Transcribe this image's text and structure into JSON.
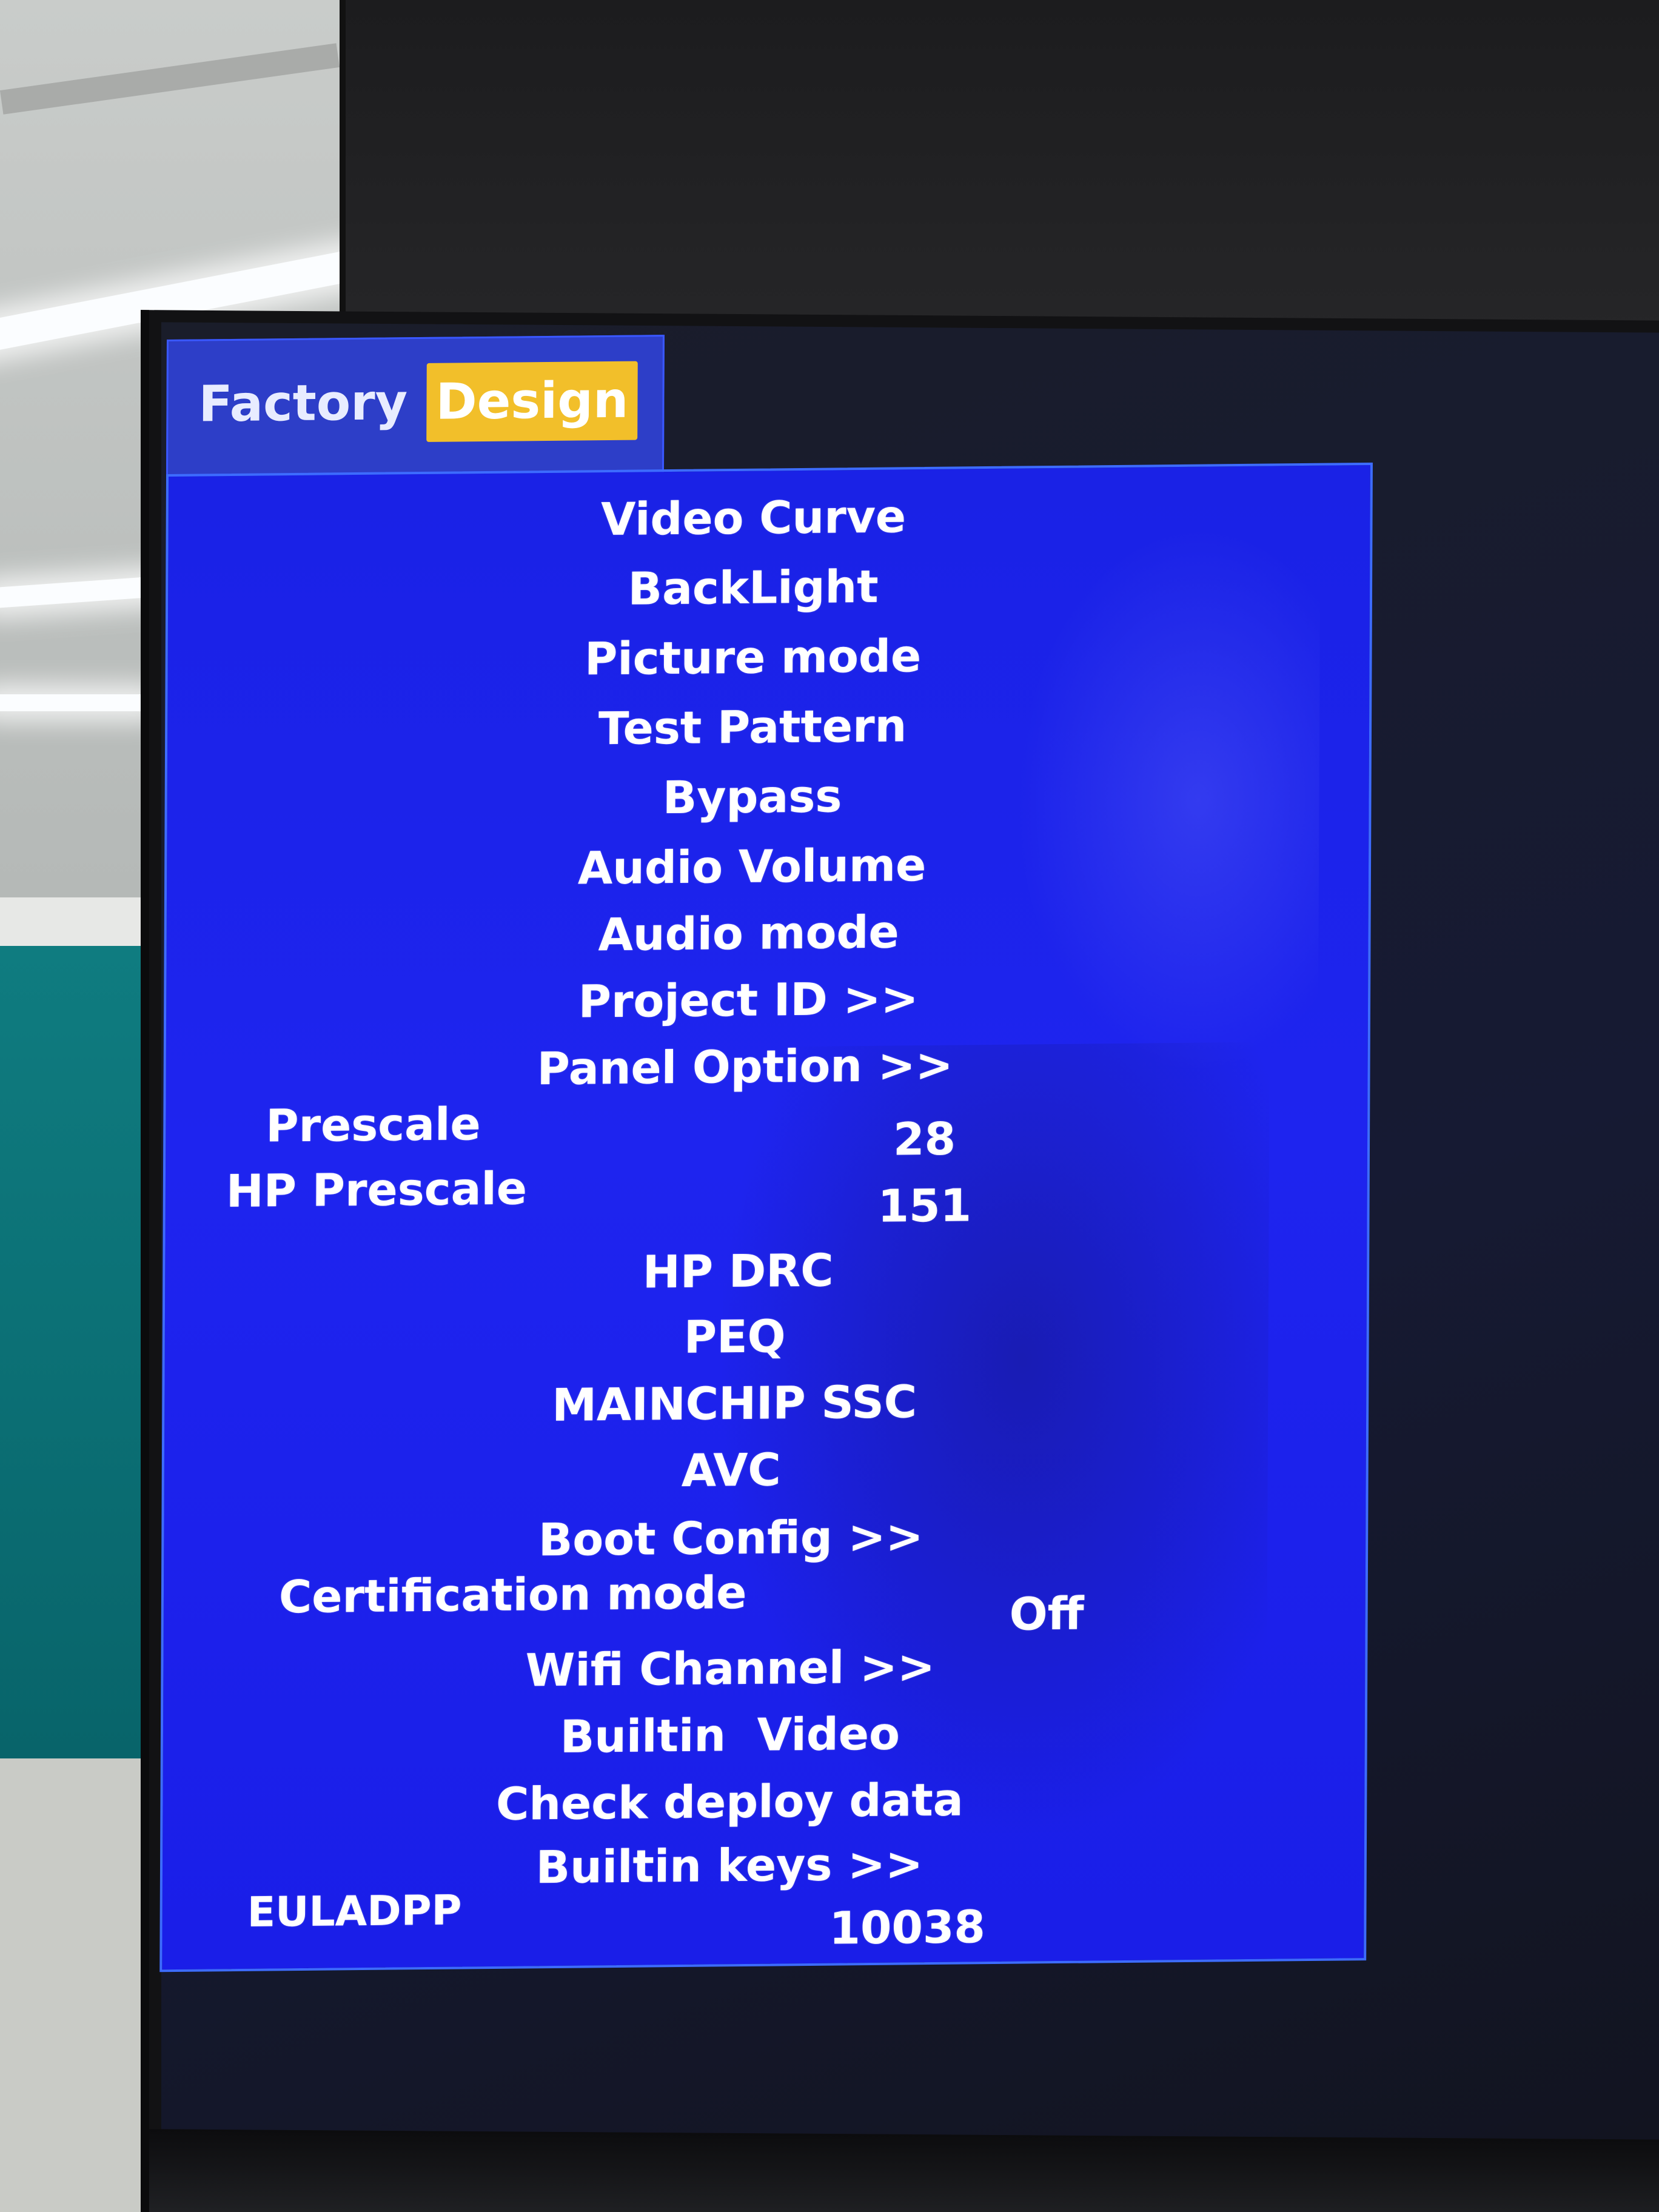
{
  "tabs": [
    {
      "label": "Factory"
    },
    {
      "label": "Design"
    }
  ],
  "menu_items": [
    {
      "label": "Video Curve"
    },
    {
      "label": "BackLight"
    },
    {
      "label": "Picture mode"
    },
    {
      "label": "Test Pattern"
    },
    {
      "label": "Bypass"
    },
    {
      "label": "Audio Volume"
    },
    {
      "label": "Audio mode"
    },
    {
      "label": "Project ID >>"
    },
    {
      "label": "Panel Option >>"
    },
    {
      "label": "Prescale",
      "value": "28"
    },
    {
      "label": "HP Prescale",
      "value": "151"
    },
    {
      "label": "HP DRC"
    },
    {
      "label": "PEQ"
    },
    {
      "label": "MAINCHIP SSC"
    },
    {
      "label": "AVC"
    },
    {
      "label": "Boot Config >>"
    },
    {
      "label": "Certification mode",
      "value": "Off"
    },
    {
      "label": "Wifi Channel >>"
    },
    {
      "label": "Builtin  Video"
    },
    {
      "label": "Check deploy data"
    },
    {
      "label": "Builtin keys >>"
    },
    {
      "label": "EULADPP",
      "value": "10038"
    }
  ],
  "colors": {
    "menu_background": "#1d22ec",
    "tab_bar": "#2d3ec8",
    "active_tab": "#f2bf2a",
    "text": "#ffffff"
  }
}
